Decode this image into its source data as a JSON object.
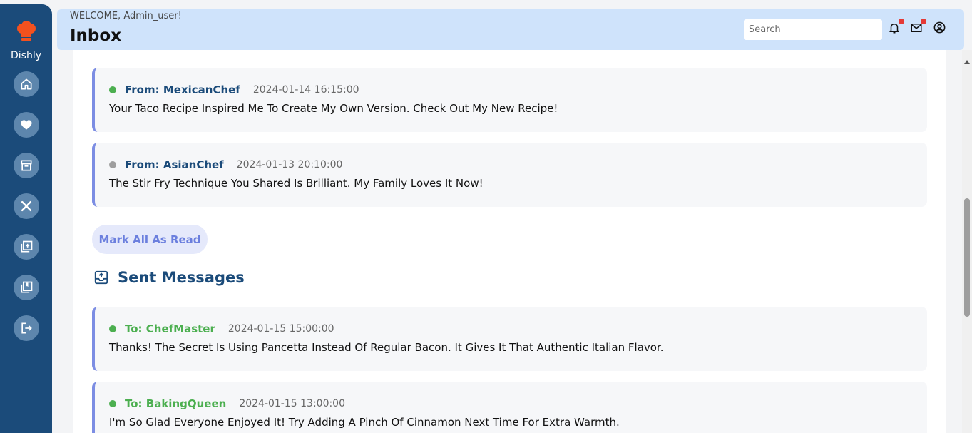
{
  "sidebar": {
    "brand": "Dishly",
    "items": [
      {
        "icon": "home-icon"
      },
      {
        "icon": "heart-icon"
      },
      {
        "icon": "archive-icon"
      },
      {
        "icon": "utensils-icon"
      },
      {
        "icon": "add-recipe-icon"
      },
      {
        "icon": "bookmark-collection-icon"
      },
      {
        "icon": "logout-icon"
      }
    ]
  },
  "header": {
    "welcome": "WELCOME, Admin_user!",
    "title": "Inbox",
    "search_placeholder": "Search"
  },
  "received": [
    {
      "from": "From: MexicanChef",
      "time": "2024-01-14 16:15:00",
      "text": "Your Taco Recipe Inspired Me To Create My Own Version. Check Out My New Recipe!",
      "status_color": "#4caf50"
    },
    {
      "from": "From: AsianChef",
      "time": "2024-01-13 20:10:00",
      "text": "The Stir Fry Technique You Shared Is Brilliant. My Family Loves It Now!",
      "status_color": "#9e9e9e"
    }
  ],
  "mark_all_label": "Mark All As Read",
  "sent_title": "Sent Messages",
  "sent": [
    {
      "to": "To: ChefMaster",
      "time": "2024-01-15 15:00:00",
      "text": "Thanks! The Secret Is Using Pancetta Instead Of Regular Bacon. It Gives It That Authentic Italian Flavor.",
      "status_color": "#4caf50"
    },
    {
      "to": "To: BakingQueen",
      "time": "2024-01-15 13:00:00",
      "text": "I'm So Glad Everyone Enjoyed It! Try Adding A Pinch Of Cinnamon Next Time For Extra Warmth.",
      "status_color": "#4caf50"
    }
  ],
  "colors": {
    "sidebar": "#1b4b7a",
    "header": "#cfe3fb",
    "accent": "#7c8de3",
    "sent_name": "#4caf50"
  }
}
